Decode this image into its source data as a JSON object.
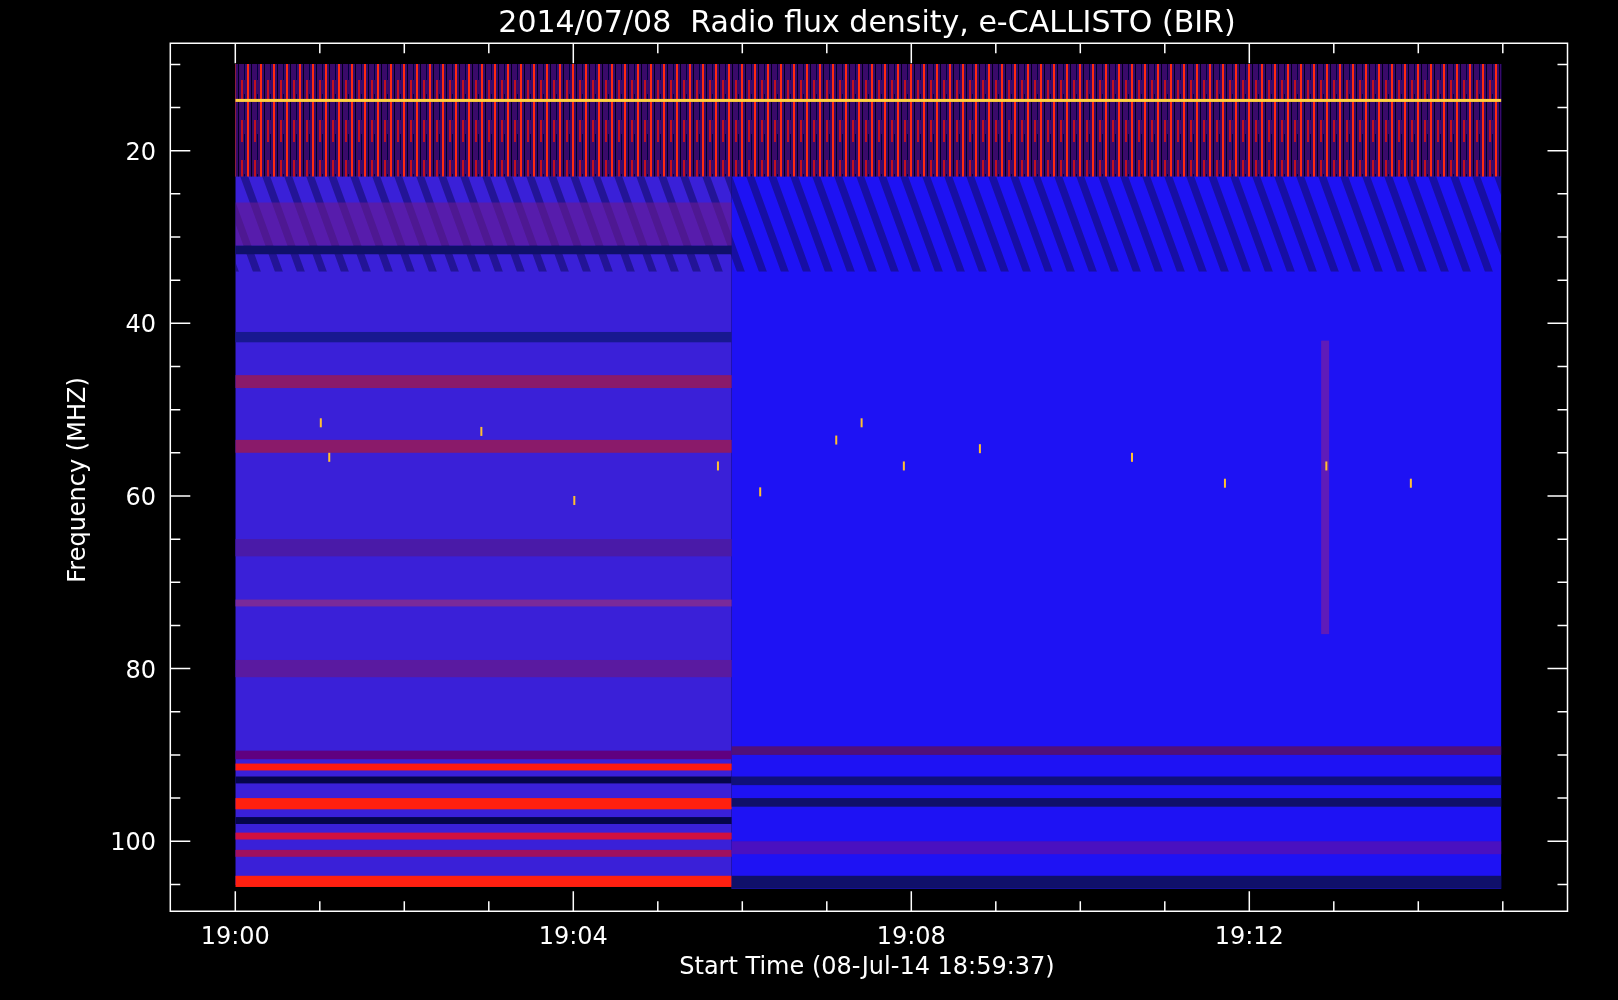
{
  "title": "2014/07/08  Radio flux density, e-CALLISTO (BIR)",
  "x_axis": {
    "label": "Start Time (08-Jul-14 18:59:37)",
    "ticks": [
      "19:00",
      "19:04",
      "19:08",
      "19:12"
    ]
  },
  "y_axis": {
    "label": "Frequency (MHZ)",
    "ticks": [
      "20",
      "40",
      "60",
      "80",
      "100"
    ]
  }
}
